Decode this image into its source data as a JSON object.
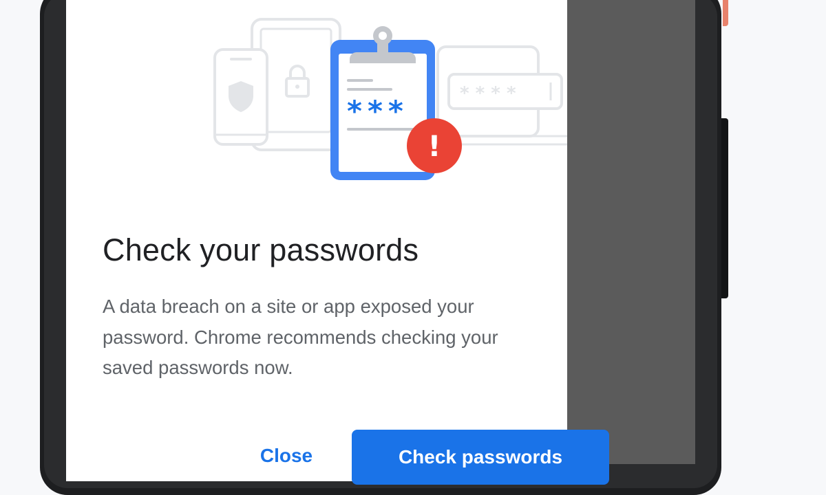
{
  "dialog": {
    "title": "Check your passwords",
    "message": "A data breach on a site or app exposed your password. Chrome recommends checking your saved passwords now.",
    "close_label": "Close",
    "primary_label": "Check passwords"
  },
  "illustration": {
    "password_mask": "* * * *",
    "clipboard_mask": "***",
    "alert_mark": "!"
  },
  "colors": {
    "accent": "#1a73e8",
    "alert": "#ea4335",
    "title_text": "#202124",
    "body_text": "#5f6368",
    "illustration_line": "#e3e5e8"
  }
}
